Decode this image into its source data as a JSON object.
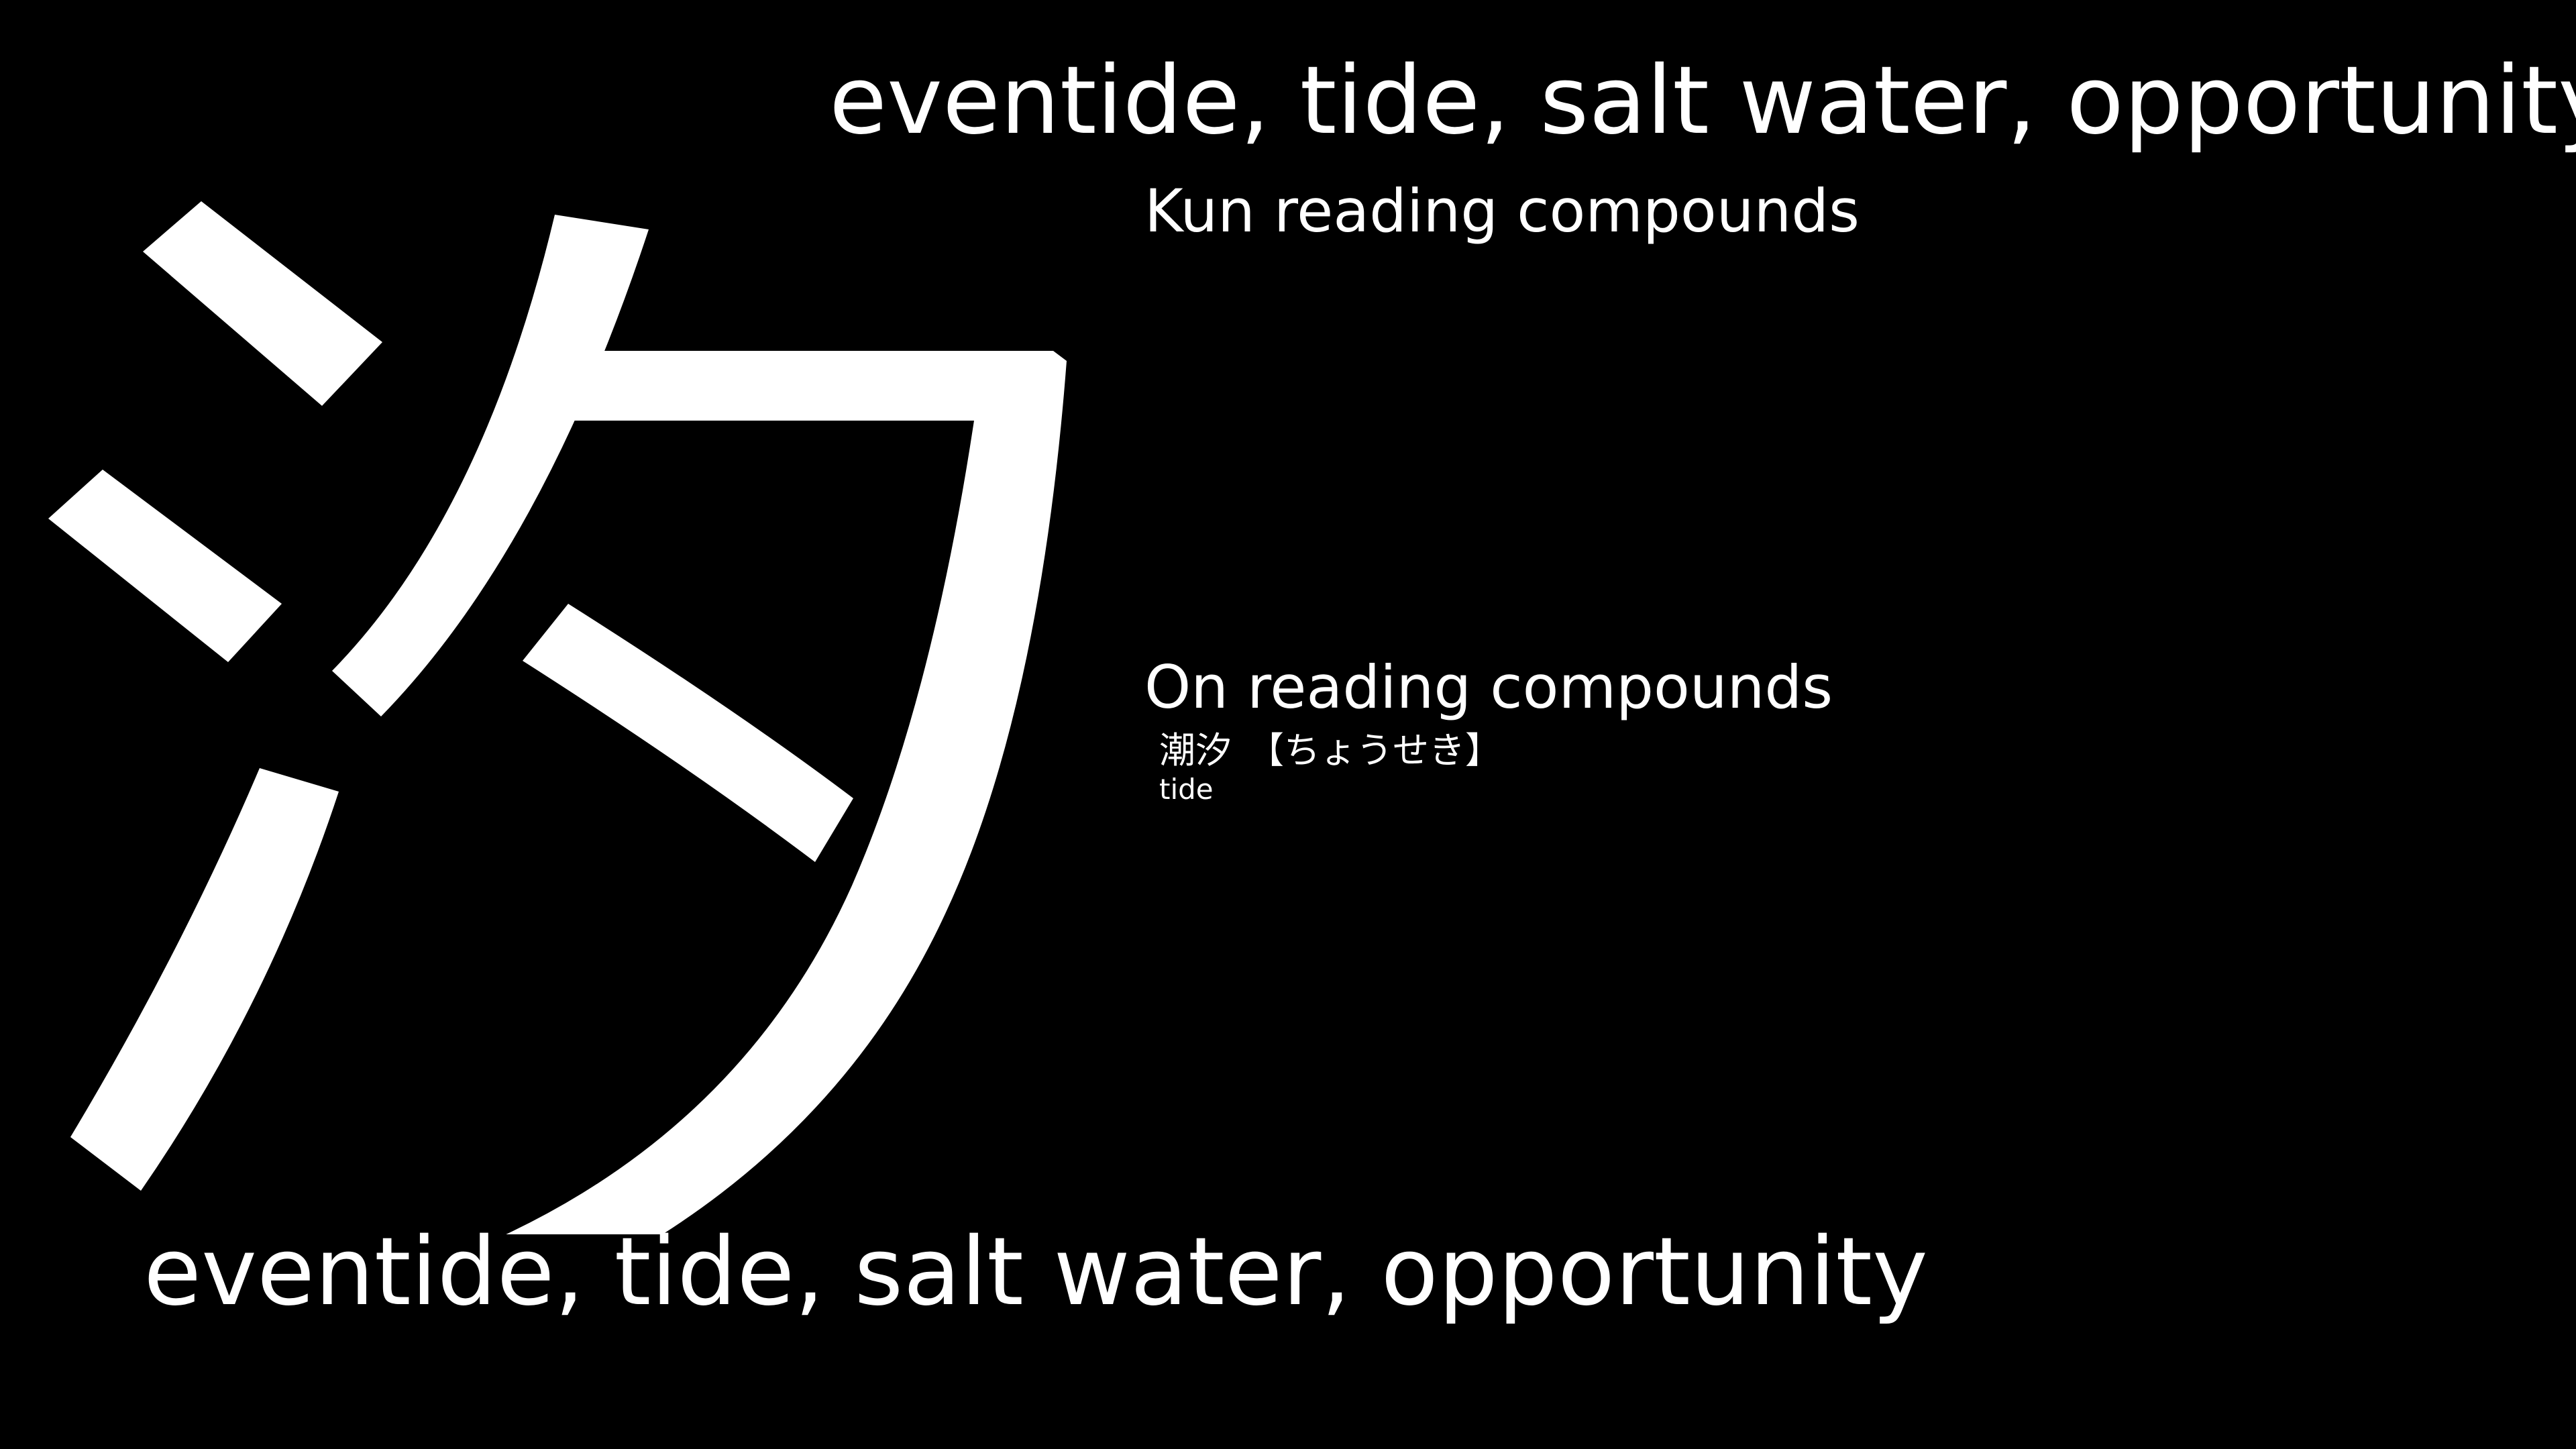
{
  "kanji": {
    "character": "汐",
    "color": "#ffffff"
  },
  "meanings": {
    "top": "eventide, tide, salt water, opportunity",
    "bottom": "eventide, tide, salt water, opportunity"
  },
  "kun_section": {
    "heading": "Kun reading compounds",
    "compounds": []
  },
  "on_section": {
    "heading": "On reading compounds",
    "compounds": [
      {
        "word": "潮汐",
        "reading": "【ちょうせき】",
        "meaning": "tide"
      }
    ]
  },
  "colors": {
    "background": "#000000",
    "text": "#ffffff"
  }
}
